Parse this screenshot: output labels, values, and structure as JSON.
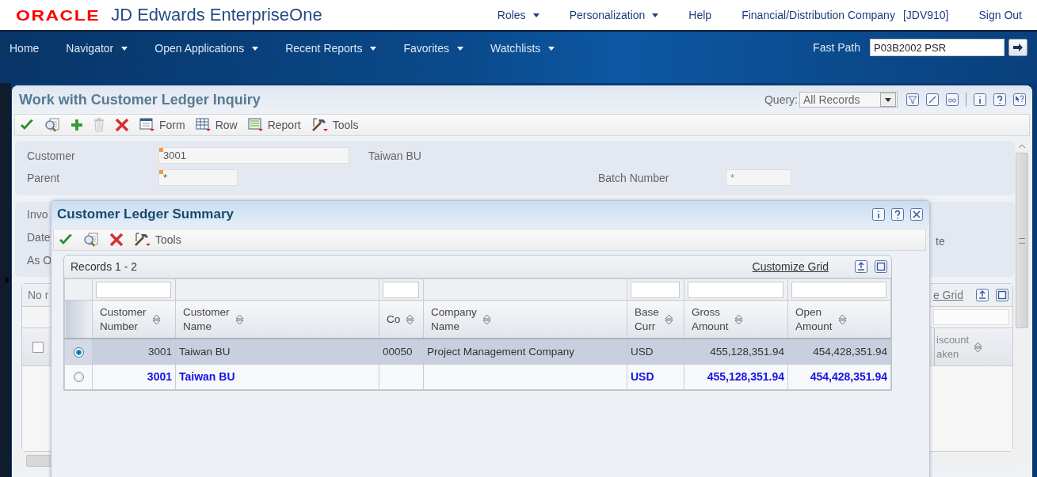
{
  "header": {
    "logo": "ORACLE",
    "product": "JD Edwards EnterpriseOne",
    "links": [
      {
        "label": "Roles",
        "dropdown": true
      },
      {
        "label": "Personalization",
        "dropdown": true
      },
      {
        "label": "Help",
        "dropdown": false
      },
      {
        "label": "Financial/Distribution Company",
        "dropdown": false
      },
      {
        "label": "[JDV910]",
        "dropdown": false
      },
      {
        "label": "Sign Out",
        "dropdown": false
      }
    ]
  },
  "menu_bar": {
    "items": [
      {
        "label": "Home",
        "dropdown": false
      },
      {
        "label": "Navigator",
        "dropdown": true
      },
      {
        "label": "Open Applications",
        "dropdown": true
      },
      {
        "label": "Recent Reports",
        "dropdown": true
      },
      {
        "label": "Favorites",
        "dropdown": true
      },
      {
        "label": "Watchlists",
        "dropdown": true
      }
    ],
    "fast_path": {
      "label": "Fast Path",
      "value": "P03B2002 PSR"
    }
  },
  "form": {
    "title": "Work with Customer Ledger Inquiry",
    "query": {
      "label": "Query:",
      "value": "All Records"
    },
    "toolbar": [
      {
        "kind": "ok",
        "disabled": false
      },
      {
        "kind": "find",
        "disabled": false
      },
      {
        "kind": "add",
        "disabled": false
      },
      {
        "kind": "delete",
        "disabled": true
      },
      {
        "kind": "cancel",
        "disabled": false
      },
      {
        "kind": "form",
        "label": "Form",
        "disabled": false
      },
      {
        "kind": "row",
        "label": "Row",
        "disabled": false
      },
      {
        "kind": "report",
        "label": "Report",
        "disabled": false
      },
      {
        "kind": "tools",
        "label": "Tools",
        "disabled": false
      }
    ],
    "header_fields": [
      {
        "label": "Customer",
        "value": "3001",
        "required": true,
        "description": "Taiwan BU"
      },
      {
        "label": "Parent",
        "value": "*",
        "required": true
      },
      {
        "label": "Batch Number",
        "value": "*",
        "required": false
      }
    ],
    "covered_labels": [
      "Invo",
      "Date",
      "As O"
    ],
    "covered_right_label": "te",
    "background_grid": {
      "records_label": "No r",
      "customize_link": "e Grid",
      "select_all_checked": false,
      "column_heading": "iscount\naken"
    }
  },
  "dialog": {
    "title": "Customer Ledger Summary",
    "toolbar": [
      {
        "kind": "ok",
        "disabled": false
      },
      {
        "kind": "find",
        "disabled": false
      },
      {
        "kind": "cancel",
        "disabled": false
      },
      {
        "kind": "tools",
        "label": "Tools",
        "disabled": false
      }
    ],
    "grid": {
      "records_label": "Records 1 - 2",
      "customize_link": "Customize Grid",
      "columns": [
        {
          "heading": "Customer\nNumber",
          "filter": true
        },
        {
          "heading": "Customer\nName",
          "filter": false
        },
        {
          "heading": "Co",
          "filter": true
        },
        {
          "heading": "Company\nName",
          "filter": false
        },
        {
          "heading": "Base\nCurr",
          "filter": true
        },
        {
          "heading": "Gross\nAmount",
          "filter": true
        },
        {
          "heading": "Open\nAmount",
          "filter": true
        }
      ],
      "rows": [
        {
          "kind": "detail",
          "selected": true,
          "cells": [
            "3001",
            "Taiwan BU",
            "00050",
            "Project Management Company",
            "USD",
            "455,128,351.94",
            "454,428,351.94"
          ]
        },
        {
          "kind": "total",
          "selected": false,
          "cells": [
            "3001",
            "Taiwan BU",
            null,
            null,
            "USD",
            "455,128,351.94",
            "454,428,351.94"
          ]
        }
      ]
    }
  }
}
